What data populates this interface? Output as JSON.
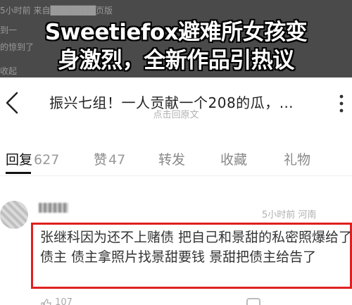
{
  "banner": {
    "bg_line_1": "5小时前 来自███████页版",
    "bg_line_2": "到一",
    "bg_line_3": "的惊到了",
    "bg_line_4": "收起",
    "headline_line_1": "Sweetiefox避难所女孩变",
    "headline_line_2": "身激烈，全新作品引热议"
  },
  "header": {
    "post_title": "振兴七组！一人贡献一个208的瓜，…",
    "post_sub": "点击回原文"
  },
  "tabs": [
    {
      "label": "回复",
      "count": "627"
    },
    {
      "label": "赞",
      "count": "47"
    },
    {
      "label": "转发",
      "count": ""
    },
    {
      "label": "收藏",
      "count": ""
    },
    {
      "label": "礼物",
      "count": ""
    }
  ],
  "comment": {
    "meta": "5小时前 河南",
    "text": "张继科因为还不上赌债 把自己和景甜的私密照爆给了债主 债主拿照片找景甜要钱 景甜把债主给告了",
    "likes": "107"
  },
  "colors": {
    "highlight_border": "#e02020",
    "banner_bg": "#4a4a4a"
  },
  "icons": [
    "back-icon",
    "more-icon",
    "like-icon",
    "reply-icon"
  ]
}
